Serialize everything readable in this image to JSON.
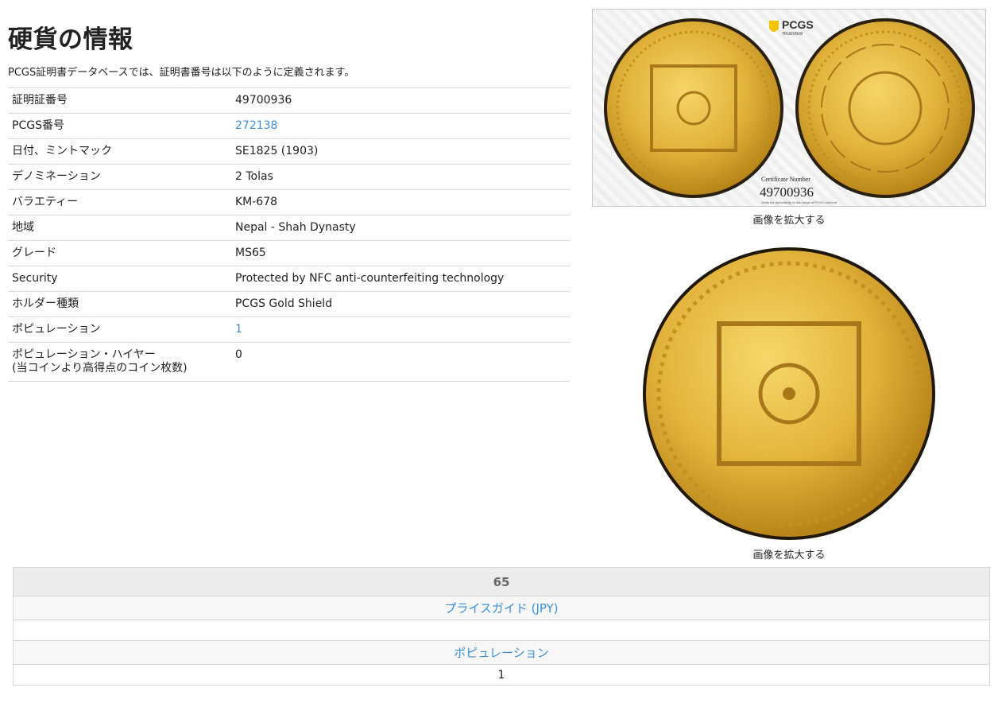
{
  "page": {
    "title": "硬貨の情報",
    "intro": "PCGS証明書データベースでは、証明書番号は以下のように定義されます。"
  },
  "info_rows": [
    {
      "label": "証明証番号",
      "value": "49700936",
      "link": false
    },
    {
      "label": "PCGS番号",
      "value": "272138",
      "link": true
    },
    {
      "label": "日付、ミントマック",
      "value": "SE1825 (1903)",
      "link": false
    },
    {
      "label": "デノミネーション",
      "value": "2 Tolas",
      "link": false
    },
    {
      "label": "バラエティー",
      "value": "KM-678",
      "link": false
    },
    {
      "label": "地域",
      "value": "Nepal - Shah Dynasty",
      "link": false
    },
    {
      "label": "グレード",
      "value": "MS65",
      "link": false
    },
    {
      "label": "Security",
      "value": "Protected by NFC anti-counterfeiting technology",
      "link": false
    },
    {
      "label": "ホルダー種類",
      "value": "PCGS Gold Shield",
      "link": false
    },
    {
      "label": "ポピュレーション",
      "value": "1",
      "link": true
    },
    {
      "label": "ポピュレーション・ハイヤー\n(当コインより高得点のコイン枚数)",
      "value": "0",
      "link": false
    }
  ],
  "images": {
    "slab": {
      "brand": "PCGS",
      "brand_sub": "TRUEVIEW",
      "cert_label": "Certificate Number",
      "cert_number": "49700936",
      "verify_text": "Verify the authenticity of this image at PCGS.com/cert"
    },
    "caption1": "画像を拡大する",
    "caption2": "画像を拡大する",
    "coin_color": "#e0b23a"
  },
  "grades": {
    "grade": "65",
    "price_guide": "プライスガイド (JPY)",
    "price_value": "",
    "population_link": "ポピュレーション",
    "population_value": "1"
  }
}
